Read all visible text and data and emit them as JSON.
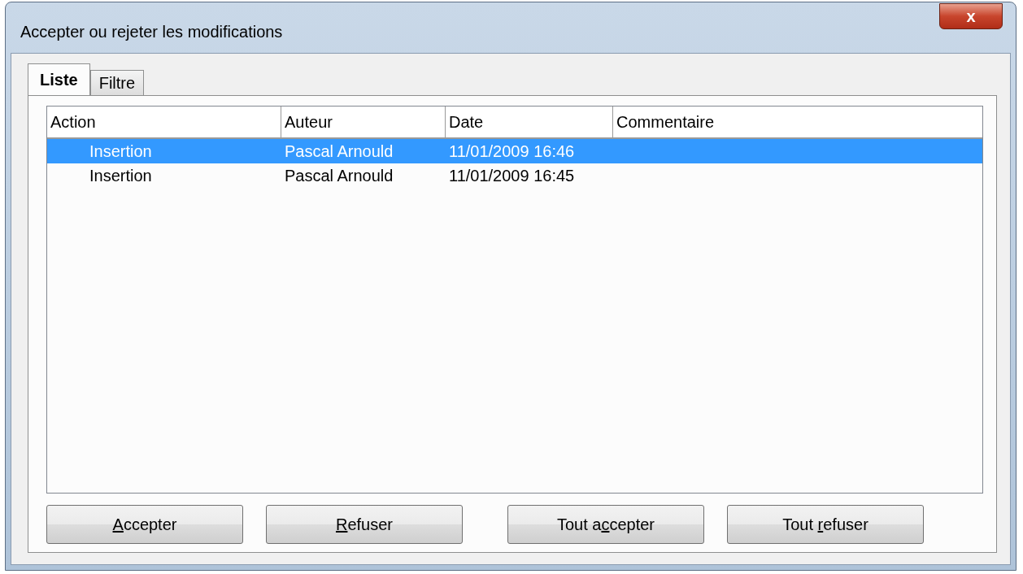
{
  "window": {
    "title": "Accepter ou rejeter les modifications",
    "close": "x"
  },
  "tabs": [
    {
      "label": "Liste",
      "selected": true
    },
    {
      "label": "Filtre",
      "selected": false
    }
  ],
  "table": {
    "columns": [
      "Action",
      "Auteur",
      "Date",
      "Commentaire"
    ],
    "rows": [
      {
        "cells": [
          "Insertion",
          "Pascal Arnould",
          "11/01/2009 16:46"
        ],
        "selected": true
      },
      {
        "cells": [
          "Insertion",
          "Pascal Arnould",
          "11/01/2009 16:45"
        ],
        "selected": false
      }
    ]
  },
  "buttons": [
    {
      "key": "A",
      "after": "ccepter"
    },
    {
      "key": "R",
      "after": "efuser"
    },
    {
      "before": "Tout a",
      "key": "c",
      "after": "cepter"
    },
    {
      "before": "Tout ",
      "key": "r",
      "after": "efuser"
    }
  ]
}
